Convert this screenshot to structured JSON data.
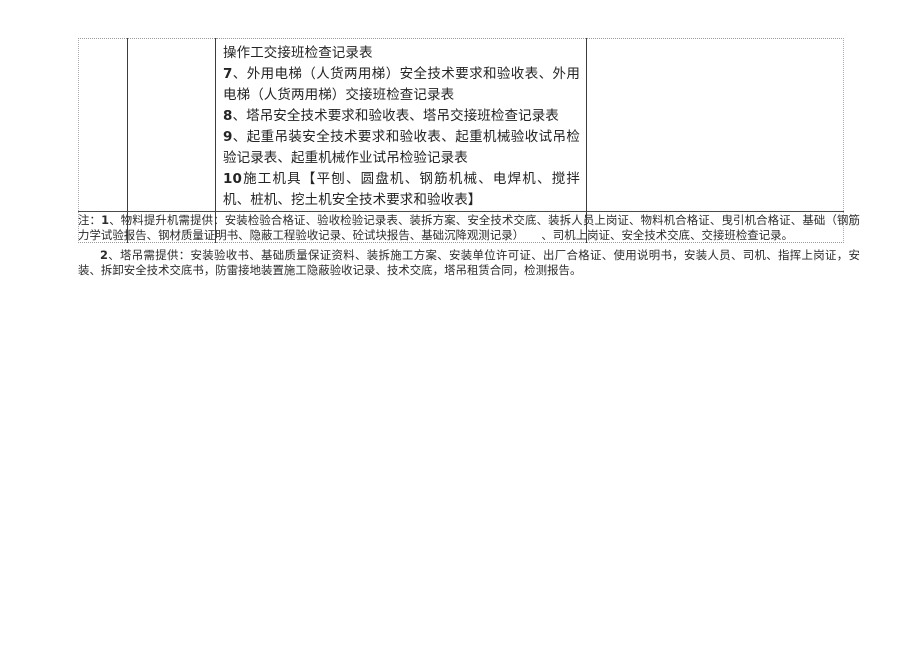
{
  "document": {
    "type": "form-table-page",
    "page_background": "#ffffff",
    "text_color": "#242424",
    "border_color_solid": "#3d3d3d",
    "border_color_dotted": "#9a9a9a"
  },
  "table": {
    "columns": 4,
    "rows": [
      {
        "name": "content-row",
        "cells": [
          {
            "name": "cell-col1",
            "text": ""
          },
          {
            "name": "cell-col2",
            "text": ""
          },
          {
            "name": "cell-col3",
            "lines": [
              {
                "lead": "",
                "text": "操作工交接班检查记录表"
              },
              {
                "lead": "7",
                "text": "、外用电梯（人货两用梯）安全技术要求和验收表、外用电梯（人货两用梯）交接班检查记录表"
              },
              {
                "lead": "8",
                "text": "、塔吊安全技术要求和验收表、塔吊交接班检查记录表"
              },
              {
                "lead": "9",
                "text": "、起重吊装安全技术要求和验收表、起重机械验收试吊检验记录表、起重机械作业试吊检验记录表"
              },
              {
                "lead": "10",
                "text": "施工机具【平刨、圆盘机、钢筋机械、电焊机、搅拌机、桩机、挖土机安全技术要求和验收表】"
              }
            ]
          },
          {
            "name": "cell-col4",
            "text": ""
          }
        ]
      },
      {
        "name": "blank-row",
        "cells": [
          {
            "name": "cell-col1",
            "text": ""
          },
          {
            "name": "cell-col2",
            "text": ""
          },
          {
            "name": "cell-col3",
            "text": ""
          },
          {
            "name": "cell-col4",
            "text": ""
          }
        ]
      }
    ]
  },
  "notes": {
    "note1": {
      "prefix": "注：",
      "num": "1",
      "text": "、物料提升机需提供：安装检验合格证、验收检验记录表、装拆方案、安全技术交底、装拆人员上岗证、物料机合格证、曳引机合格证、基础（钢筋力学试验报告、钢材质量证明书、隐蔽工程验收记录、砼试块报告、基础沉降观测记录）　　、司机上岗证、安全技术交底、交接班检查记录。"
    },
    "note2": {
      "num": "2",
      "text": "、塔吊需提供：安装验收书、基础质量保证资料、装拆施工方案、安装单位许可证、出厂合格证、使用说明书，安装人员、司机、指挥上岗证，安装、拆卸安全技术交底书，防雷接地装置施工隐蔽验收记录、技术交底，塔吊租赁合同，检测报告。"
    }
  }
}
